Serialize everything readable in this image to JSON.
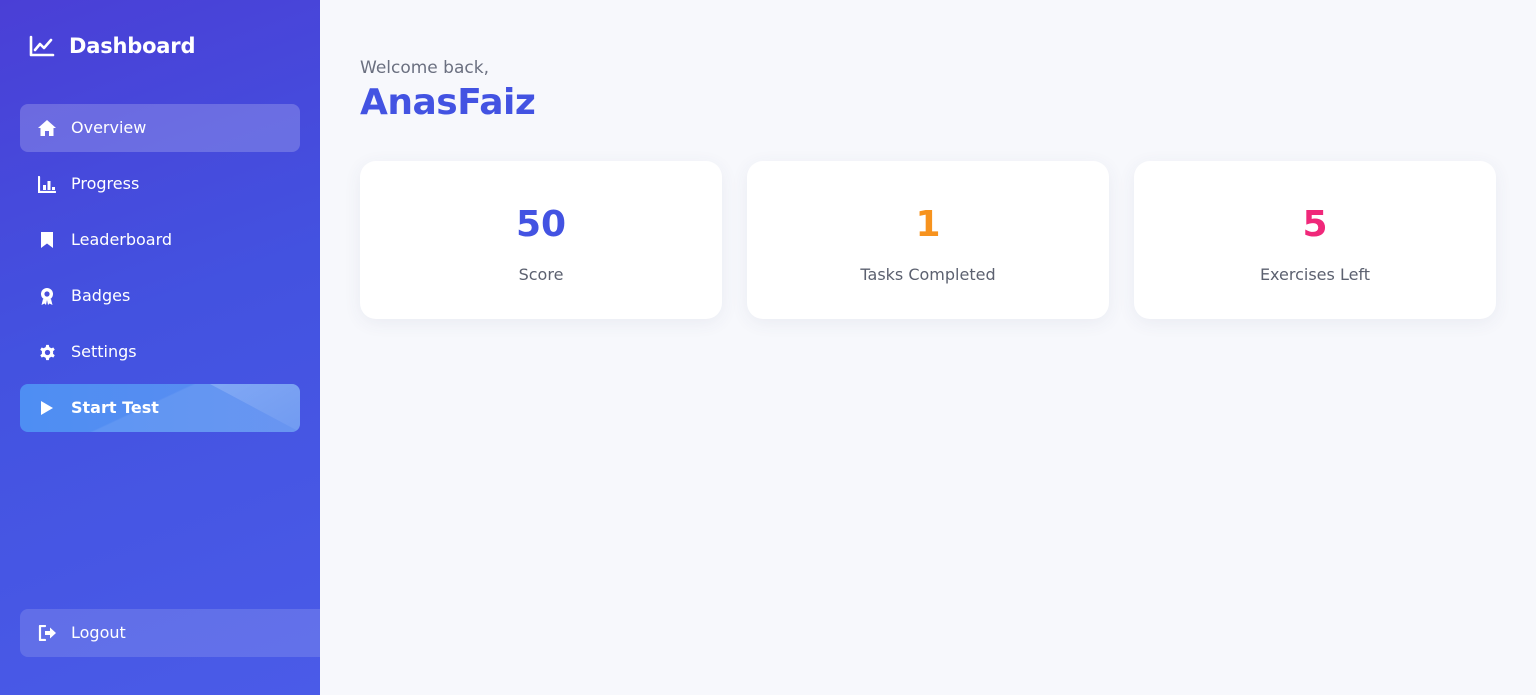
{
  "sidebar": {
    "brand": {
      "title": "Dashboard",
      "icon": "chart-line-icon"
    },
    "items": [
      {
        "label": "Overview",
        "icon": "home-icon",
        "active": true
      },
      {
        "label": "Progress",
        "icon": "bar-chart-icon"
      },
      {
        "label": "Leaderboard",
        "icon": "bookmark-icon"
      },
      {
        "label": "Badges",
        "icon": "award-icon"
      },
      {
        "label": "Settings",
        "icon": "gear-icon"
      }
    ],
    "start_test": {
      "label": "Start Test",
      "icon": "play-icon"
    },
    "logout": {
      "label": "Logout",
      "icon": "logout-icon"
    }
  },
  "main": {
    "welcome": "Welcome back,",
    "username": "AnasFaiz",
    "stats": [
      {
        "value": "50",
        "label": "Score",
        "color": "#4353e2"
      },
      {
        "value": "1",
        "label": "Tasks Completed",
        "color": "#f7931e"
      },
      {
        "value": "5",
        "label": "Exercises Left",
        "color": "#f0287a"
      }
    ]
  },
  "colors": {
    "accent": "#4353e2",
    "sidebar_bg": "#4a49dc",
    "page_bg": "#f7f8fc"
  }
}
